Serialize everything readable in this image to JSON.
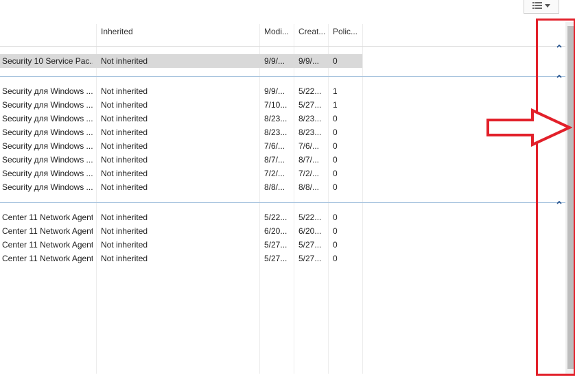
{
  "toolbar": {
    "view_button_icon": "view-options-icon"
  },
  "columns": {
    "inherited": "Inherited",
    "modified": "Modi...",
    "created": "Creat...",
    "policies": "Polic..."
  },
  "groups": [
    {
      "rows": [
        {
          "name": "Security 10 Service Pac...",
          "inherited": "Not inherited",
          "modified": "9/9/...",
          "created": "9/9/...",
          "policies": "0"
        }
      ]
    },
    {
      "rows": [
        {
          "name": "Security для Windows ...",
          "inherited": "Not inherited",
          "modified": "9/9/...",
          "created": "5/22...",
          "policies": "1"
        },
        {
          "name": "Security для Windows ...",
          "inherited": "Not inherited",
          "modified": "7/10...",
          "created": "5/27...",
          "policies": "1"
        },
        {
          "name": "Security для Windows ...",
          "inherited": "Not inherited",
          "modified": "8/23...",
          "created": "8/23...",
          "policies": "0"
        },
        {
          "name": "Security для Windows ...",
          "inherited": "Not inherited",
          "modified": "8/23...",
          "created": "8/23...",
          "policies": "0"
        },
        {
          "name": "Security для Windows ...",
          "inherited": "Not inherited",
          "modified": "7/6/...",
          "created": "7/6/...",
          "policies": "0"
        },
        {
          "name": "Security для Windows ...",
          "inherited": "Not inherited",
          "modified": "8/7/...",
          "created": "8/7/...",
          "policies": "0"
        },
        {
          "name": "Security для Windows ...",
          "inherited": "Not inherited",
          "modified": "7/2/...",
          "created": "7/2/...",
          "policies": "0"
        },
        {
          "name": "Security для Windows ...",
          "inherited": "Not inherited",
          "modified": "8/8/...",
          "created": "8/8/...",
          "policies": "0"
        }
      ]
    },
    {
      "rows": [
        {
          "name": "Center 11 Network Agent",
          "inherited": "Not inherited",
          "modified": "5/22...",
          "created": "5/22...",
          "policies": "0"
        },
        {
          "name": "Center 11 Network Agent",
          "inherited": "Not inherited",
          "modified": "6/20...",
          "created": "6/20...",
          "policies": "0"
        },
        {
          "name": "Center 11 Network Agent",
          "inherited": "Not inherited",
          "modified": "5/27...",
          "created": "5/27...",
          "policies": "0"
        },
        {
          "name": "Center 11 Network Agent",
          "inherited": "Not inherited",
          "modified": "5/27...",
          "created": "5/27...",
          "policies": "0"
        }
      ]
    }
  ],
  "colors": {
    "highlight_red": "#e2202a",
    "group_line": "#a7c3de",
    "selected_row": "#d9d9d9"
  }
}
